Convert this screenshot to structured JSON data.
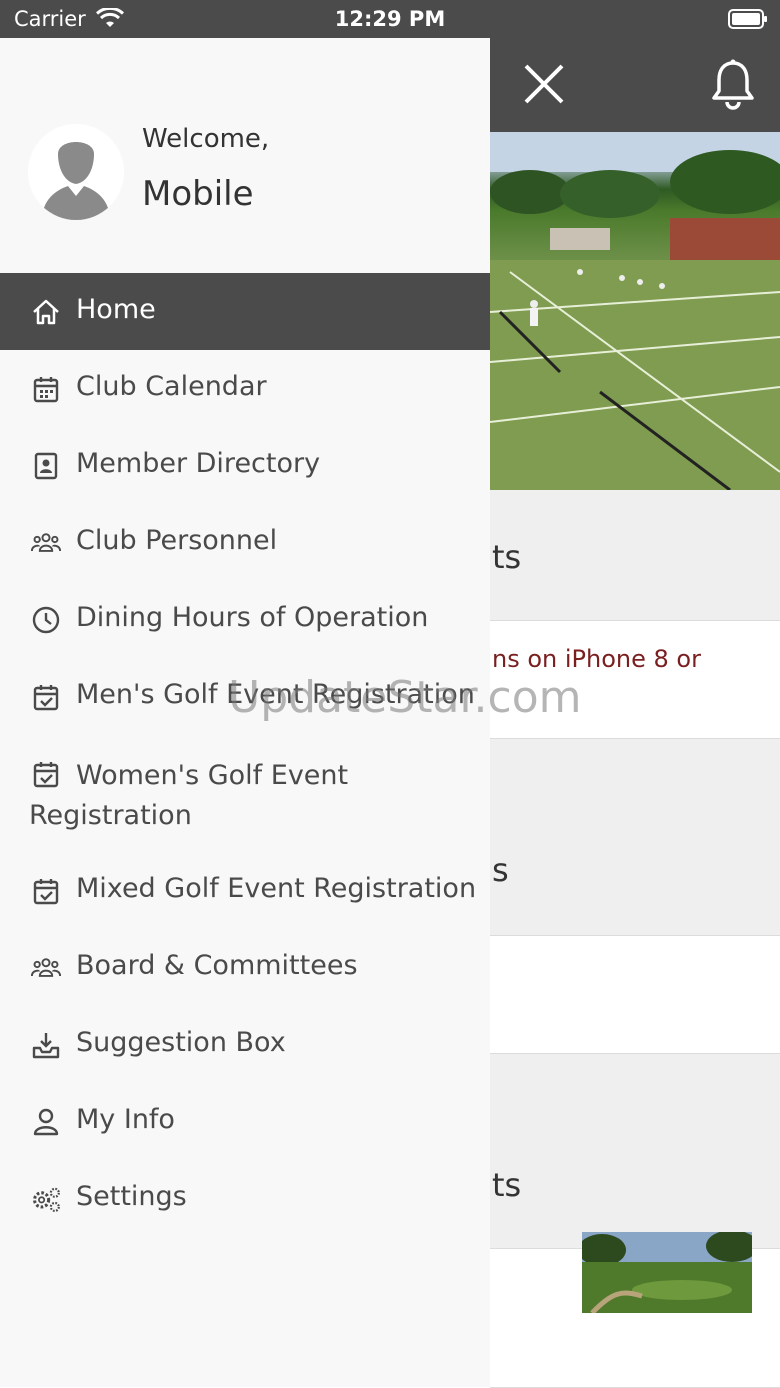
{
  "status": {
    "carrier": "Carrier",
    "time": "12:29 PM"
  },
  "drawer": {
    "welcome": "Welcome,",
    "username": "Mobile",
    "items": [
      {
        "label": "Home",
        "icon": "home-icon",
        "active": true
      },
      {
        "label": "Club Calendar",
        "icon": "calendar-icon"
      },
      {
        "label": "Member Directory",
        "icon": "contact-card-icon"
      },
      {
        "label": "Club Personnel",
        "icon": "users-icon"
      },
      {
        "label": "Dining Hours of Operation",
        "icon": "clock-icon"
      },
      {
        "label": "Men's Golf Event Registration",
        "icon": "calendar-check-icon"
      },
      {
        "label": "Women's Golf Event Registration",
        "icon": "calendar-check-icon"
      },
      {
        "label": "Mixed Golf Event Registration",
        "icon": "calendar-check-icon"
      },
      {
        "label": "Board & Committees",
        "icon": "users-icon"
      },
      {
        "label": "Suggestion Box",
        "icon": "inbox-icon"
      },
      {
        "label": "My Info",
        "icon": "user-icon"
      },
      {
        "label": "Settings",
        "icon": "gears-icon"
      }
    ]
  },
  "background": {
    "section1_title_fragment": "ts",
    "section1_link_fragment": "ns on iPhone 8 or",
    "section2_title_fragment": "s",
    "section3_title_fragment": "ts"
  },
  "watermark": "UpdateStar.com",
  "colors": {
    "header": "#4b4b4b",
    "drawer": "#f8f8f8",
    "active_item": "#4b4b4b",
    "link": "#7a1f1f"
  }
}
